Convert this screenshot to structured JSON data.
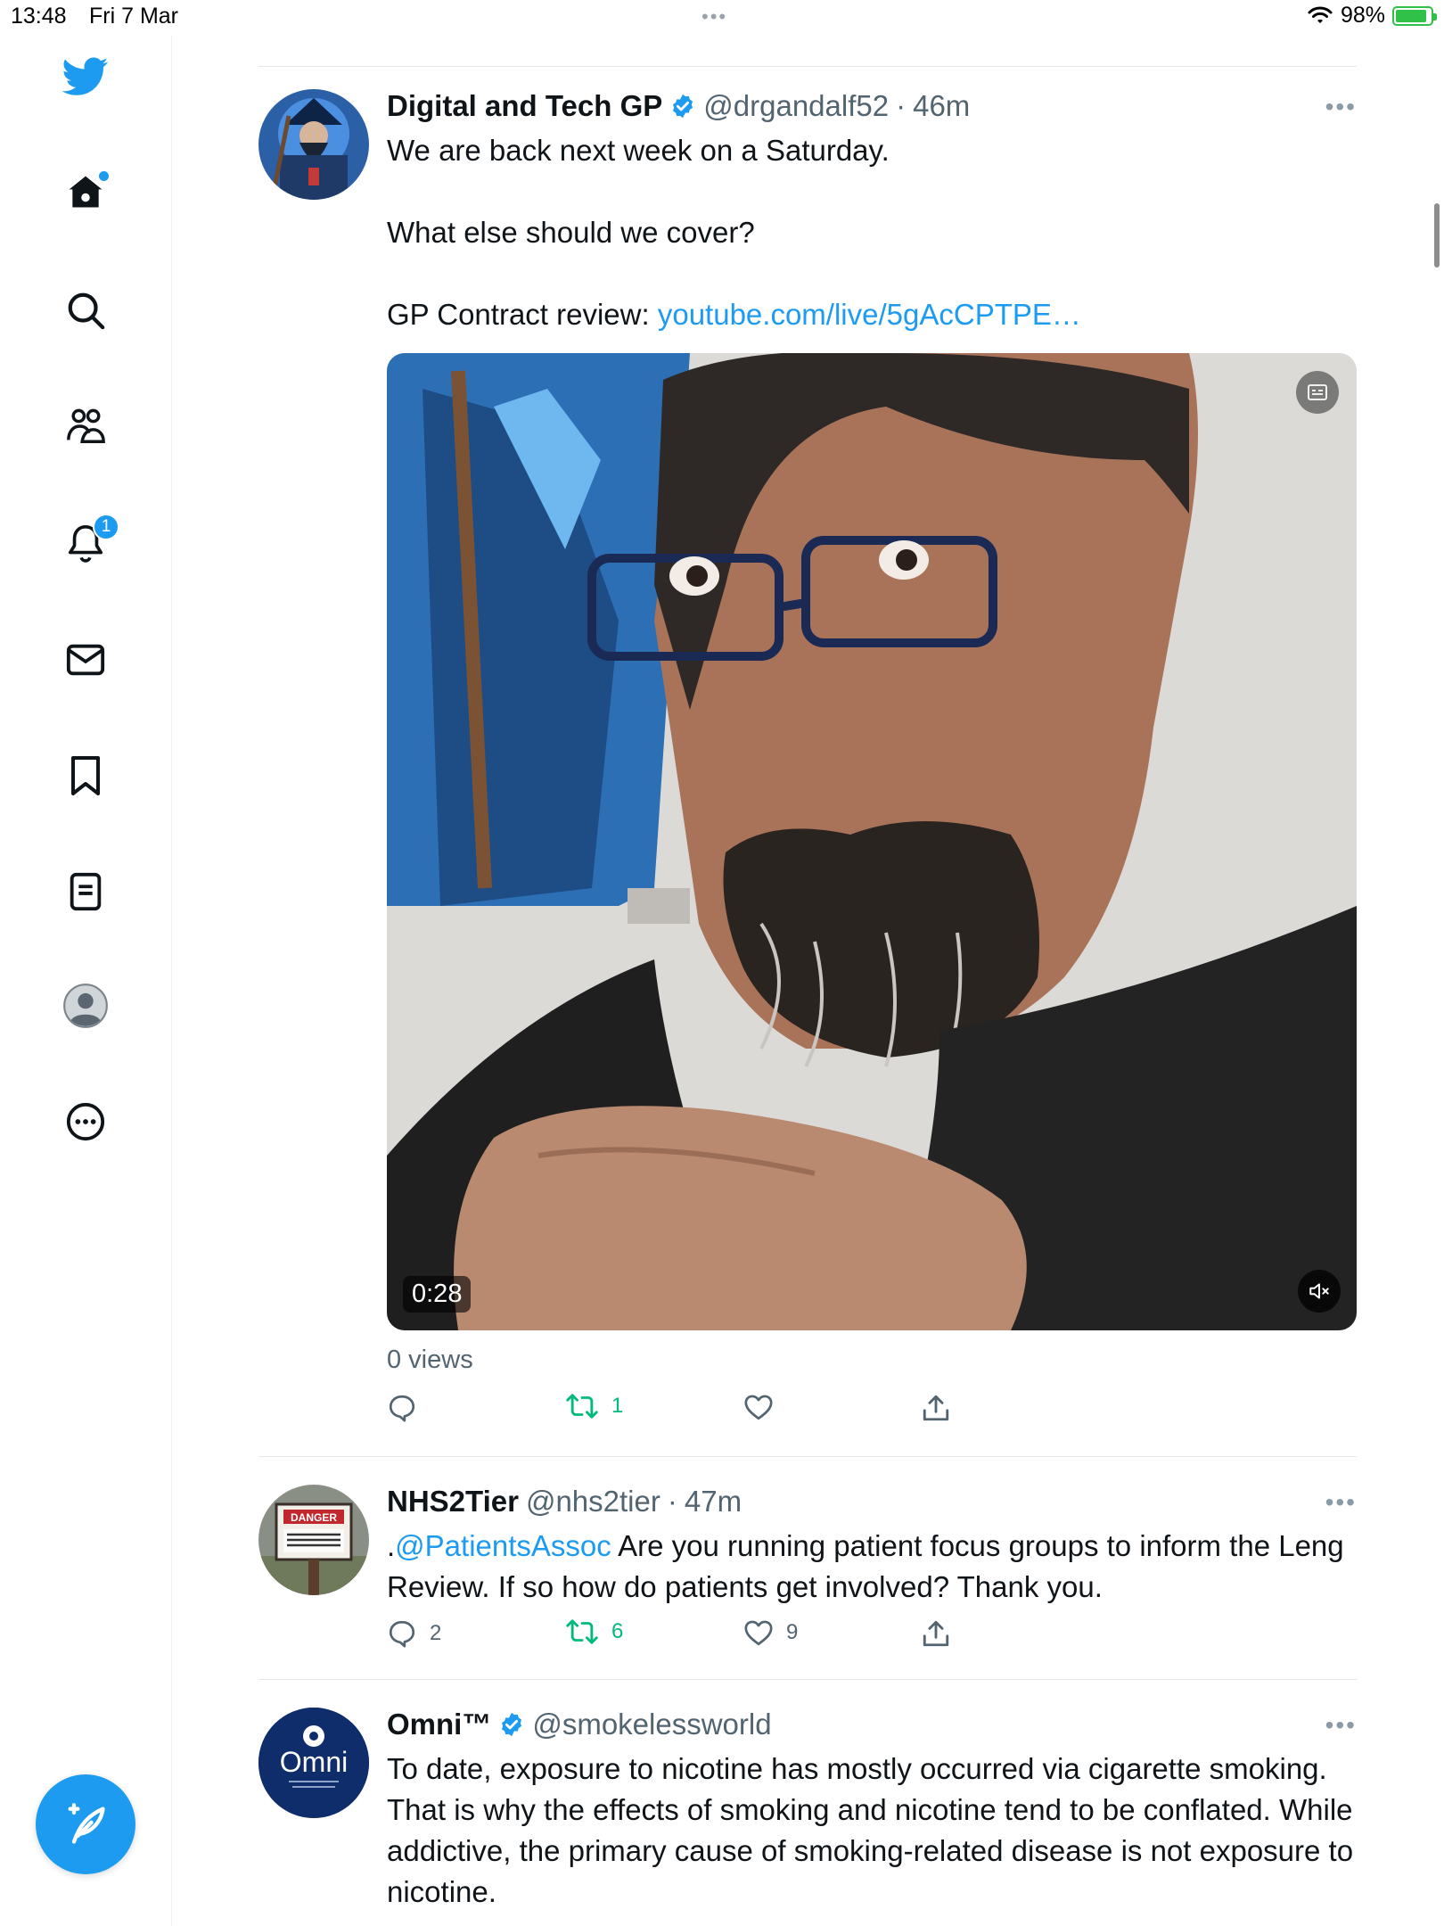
{
  "status_bar": {
    "time": "13:48",
    "date": "Fri 7 Mar",
    "dots": "•••",
    "battery": "98%"
  },
  "sidebar": {
    "notifications_badge": "1",
    "items": [
      "home-icon",
      "search-icon",
      "communities-icon",
      "notifications-icon",
      "messages-icon",
      "bookmarks-icon",
      "lists-icon",
      "profile-icon",
      "more-icon"
    ]
  },
  "tweets": [
    {
      "name": "Digital and Tech GP",
      "handle": "@drgandalf52",
      "sep": "·",
      "time": "46m",
      "verified": true,
      "lines": [
        "We are back next week on a Saturday.",
        "What else should we cover?"
      ],
      "link_prefix": "GP Contract review: ",
      "link": "youtube.com/live/5gAcCPTPE…",
      "video": {
        "duration": "0:28"
      },
      "views": "0 views",
      "replies": "",
      "retweets": "1",
      "likes": ""
    },
    {
      "name": "NHS2Tier",
      "handle": "@nhs2tier",
      "sep": "·",
      "time": "47m",
      "verified": false,
      "mention_prefix": ".",
      "mention": "@PatientsAssoc",
      "text": " Are you running patient focus groups to inform the Leng Review. If so how do patients get involved? Thank you.",
      "avatar_sign": "DANGER",
      "avatar_sign_sub": "AUTHORIZED PERSONNEL ONLY",
      "replies": "2",
      "retweets": "6",
      "likes": "9"
    },
    {
      "name": "Omni™",
      "handle": "@smokelessworld",
      "verified": true,
      "avatar_text": "Omni",
      "avatar_sub": "Forward Thinking for a Smokeless World",
      "text": "To date, exposure to nicotine has mostly occurred via cigarette smoking. That is why the effects of smoking and nicotine tend to be conflated. While addictive, the primary cause of smoking-related disease is not exposure to nicotine."
    }
  ],
  "colors": {
    "accent": "#1d9bf0",
    "retweet": "#00ba7c",
    "text": "#0f1419",
    "muted": "#536471"
  }
}
